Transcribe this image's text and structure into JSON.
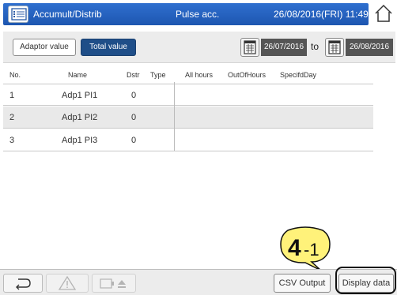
{
  "header": {
    "title": "Accumult/Distrib",
    "mode": "Pulse acc.",
    "datetime": "26/08/2016(FRI) 11:49"
  },
  "toolbar": {
    "adaptor_value": "Adaptor value",
    "total_value": "Total value",
    "date_from": "26/07/2016",
    "to": "to",
    "date_to": "26/08/2016"
  },
  "table": {
    "columns": [
      "No.",
      "Name",
      "Dstr",
      "Type",
      "All hours",
      "OutOfHours",
      "SpecifdDay"
    ],
    "rows": [
      {
        "no": "1",
        "name": "Adp1 PI1",
        "dstr": "0"
      },
      {
        "no": "2",
        "name": "Adp1 PI2",
        "dstr": "0"
      },
      {
        "no": "3",
        "name": "Adp1 PI3",
        "dstr": "0"
      }
    ]
  },
  "bottom": {
    "csv_output": "CSV Output",
    "display_data": "Display data"
  },
  "annotation": {
    "callout_main": "4",
    "callout_sub": "-1"
  },
  "colors": {
    "title_bar": "#1d56b0",
    "active_button": "#1f4e88",
    "date_field": "#555555",
    "callout": "#fff27a"
  }
}
